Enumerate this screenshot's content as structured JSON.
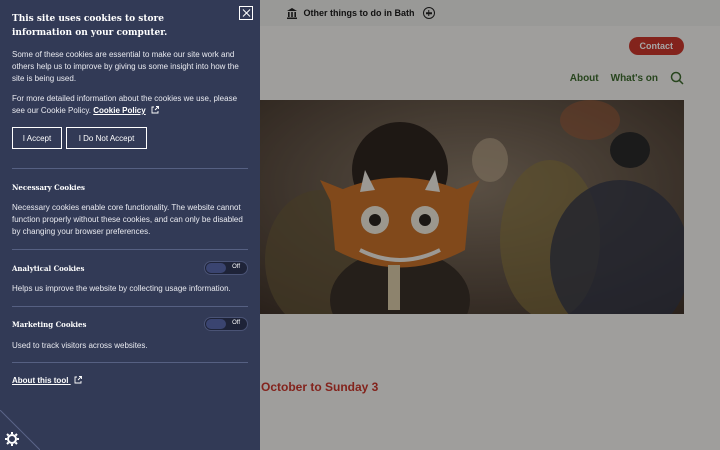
{
  "topbar": {
    "label": "Other things to do in Bath"
  },
  "header": {
    "contact_label": "Contact"
  },
  "nav": {
    "items": [
      "About",
      "What's on"
    ]
  },
  "event": {
    "date_text": "October to Sunday 3"
  },
  "cookie_panel": {
    "title": "This site uses cookies to store information on your computer.",
    "intro": "Some of these cookies are essential to make our site work and others help us to improve by giving us some insight into how the site is being used.",
    "policy_text": "For more detailed information about the cookies we use, please see our Cookie Policy.",
    "policy_link": "Cookie Policy",
    "accept_label": "I Accept",
    "deny_label": "I Do Not Accept",
    "necessary": {
      "title": "Necessary Cookies",
      "description": "Necessary cookies enable core functionality. The website cannot function properly without these cookies, and can only be disabled by changing your browser preferences."
    },
    "analytical": {
      "title": "Analytical Cookies",
      "description": "Helps us improve the website by collecting usage information.",
      "toggle_state": "Off"
    },
    "marketing": {
      "title": "Marketing Cookies",
      "description": "Used to track visitors across websites.",
      "toggle_state": "Off"
    },
    "about_link": "About this tool"
  },
  "colors": {
    "panel_bg": "#323a56",
    "accent_red": "#c9372c",
    "nav_green": "#3e6b2f"
  },
  "icons": [
    "building-icon",
    "plus-circle-icon",
    "search-icon",
    "close-icon",
    "external-link-icon",
    "cookie-settings-icon"
  ]
}
